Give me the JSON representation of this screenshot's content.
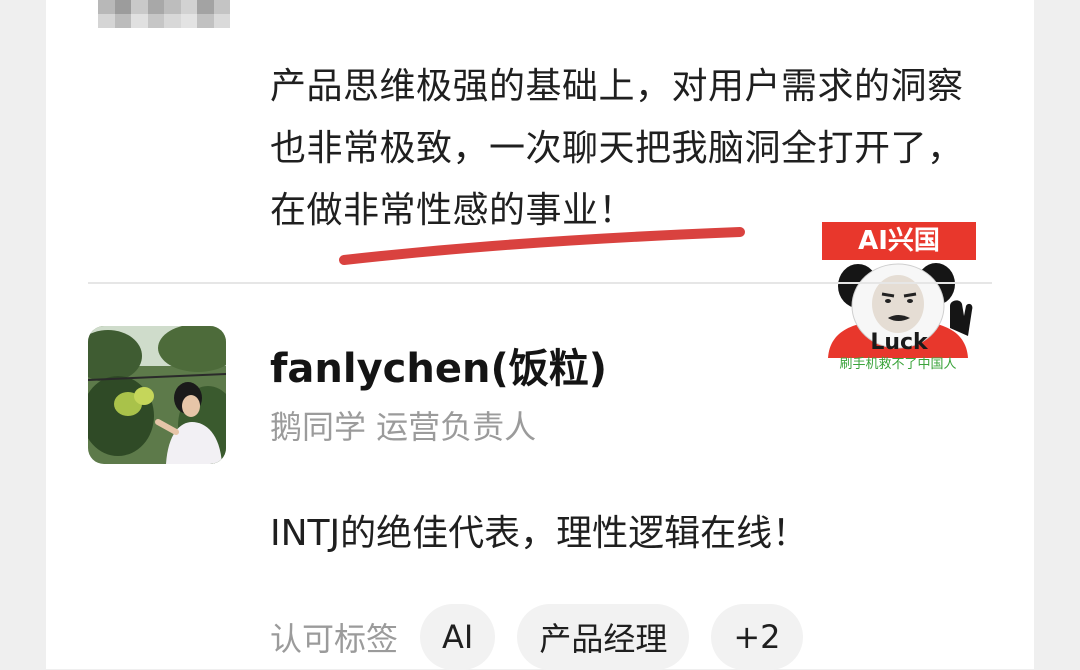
{
  "review": {
    "text_before": "产品思维极强的基础上，对用户需求的洞察也非常极致，一次聊天把我脑洞全打开了，",
    "text_highlight": "在做非常性感的事业！"
  },
  "sticker": {
    "banner": "AI兴国",
    "luck": "Luck",
    "caption": "刷手机救不了中国人"
  },
  "user": {
    "name": "fanlychen(饭粒)",
    "role": "鹅同学 运营负责人",
    "comment": "INTJ的绝佳代表，理性逻辑在线！"
  },
  "tags": {
    "label": "认可标签",
    "items": [
      "AI",
      "产品经理",
      "+2"
    ]
  },
  "colors": {
    "underline": "#d9423f",
    "sticker_red": "#e8372c",
    "muted_text": "#9b9b9b"
  }
}
